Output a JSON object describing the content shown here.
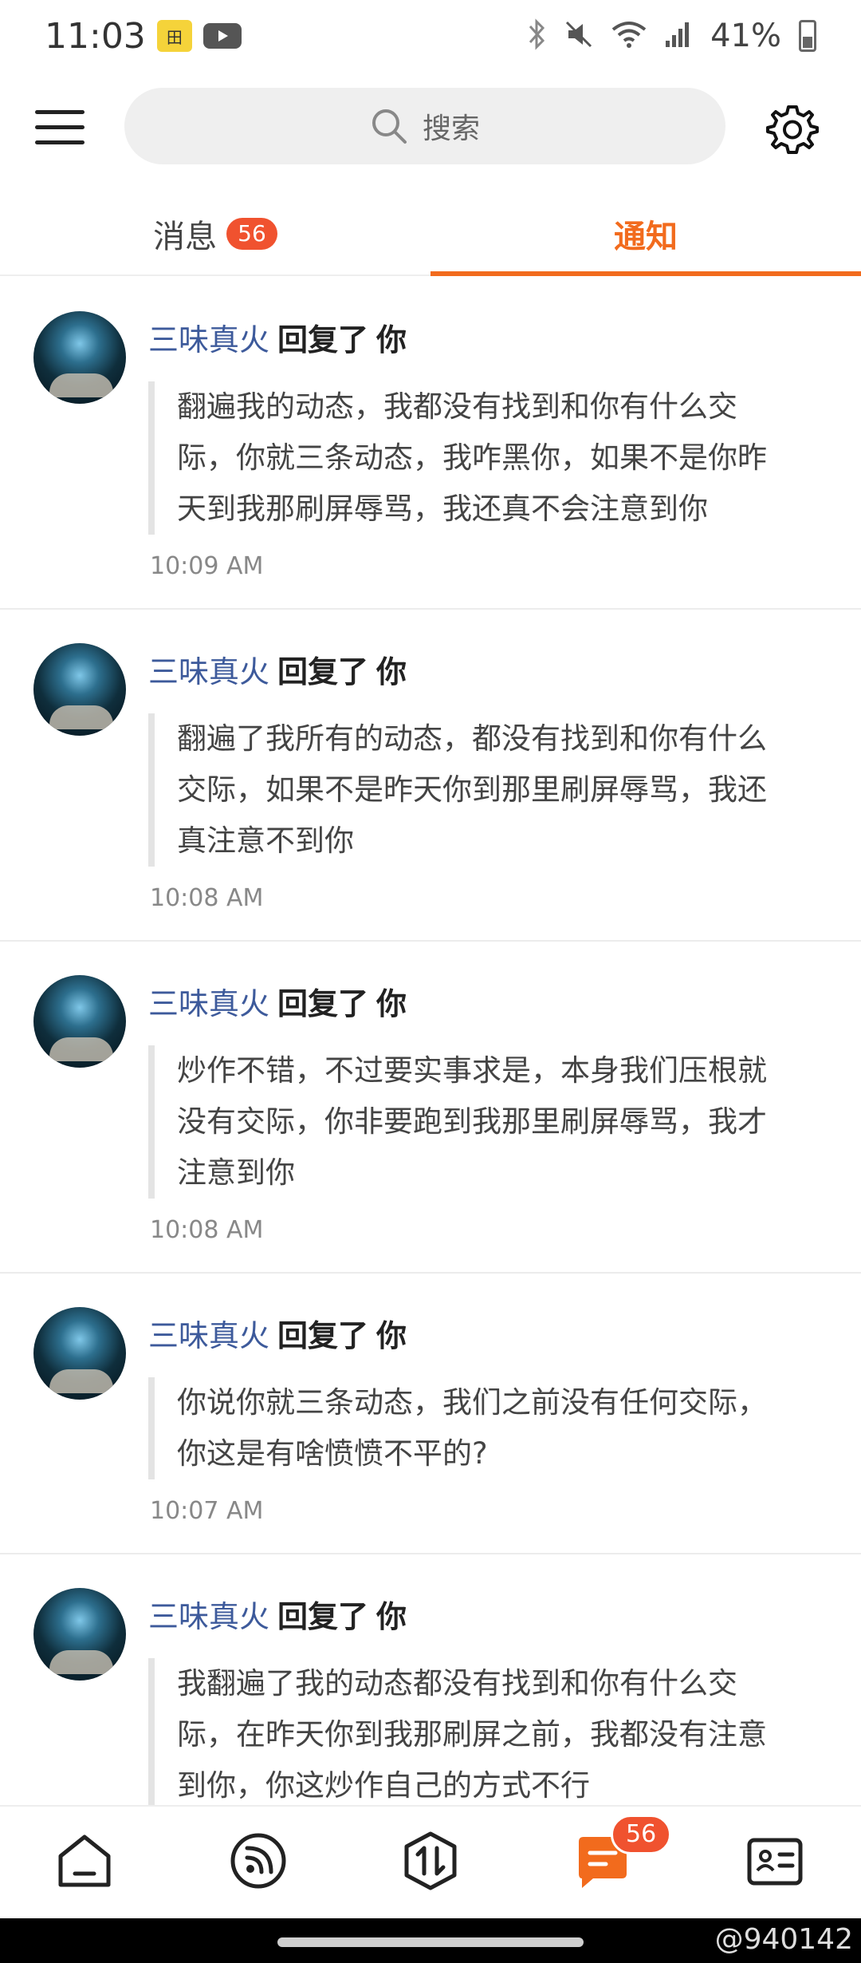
{
  "status_bar": {
    "time": "11:03",
    "battery": "41%",
    "icons": [
      "news-app-icon",
      "youtube-icon",
      "bluetooth-icon",
      "mute-icon",
      "wifi-icon",
      "signal-icon",
      "battery-icon"
    ]
  },
  "search": {
    "placeholder": "搜索"
  },
  "tabs": {
    "messages": {
      "label": "消息",
      "badge": "56"
    },
    "notices": {
      "label": "通知",
      "active": true
    }
  },
  "notifications": [
    {
      "author": "三味真火",
      "action": "回复了",
      "target": "你",
      "lines": [
        "翻遍我的动态，我都没有找到和你有什么交",
        "际，你就三条动态，我咋黑你，如果不是你昨",
        "天到我那刷屏辱骂，我还真不会注意到你"
      ],
      "time": "10:09 AM"
    },
    {
      "author": "三味真火",
      "action": "回复了",
      "target": "你",
      "lines": [
        "翻遍了我所有的动态，都没有找到和你有什么",
        "交际，如果不是昨天你到那里刷屏辱骂，我还",
        "真注意不到你"
      ],
      "time": "10:08 AM"
    },
    {
      "author": "三味真火",
      "action": "回复了",
      "target": "你",
      "lines": [
        "炒作不错，不过要实事求是，本身我们压根就",
        "没有交际，你非要跑到我那里刷屏辱骂，我才",
        "注意到你"
      ],
      "time": "10:08 AM"
    },
    {
      "author": "三味真火",
      "action": "回复了",
      "target": "你",
      "lines": [
        "你说你就三条动态，我们之前没有任何交际，",
        "你这是有啥愤愤不平的?"
      ],
      "time": "10:07 AM"
    },
    {
      "author": "三味真火",
      "action": "回复了",
      "target": "你",
      "lines": [
        "我翻遍了我的动态都没有找到和你有什么交",
        "际，在昨天你到我那刷屏之前，我都没有注意",
        "到你，你这炒作自己的方式不行"
      ],
      "time": ""
    }
  ],
  "bottom_nav": {
    "items": [
      "home-icon",
      "feed-icon",
      "exchange-icon",
      "messages-icon",
      "profile-card-icon"
    ],
    "badge": "56",
    "active_color": "#f26b1d"
  },
  "watermark": "@940142",
  "colors": {
    "accent": "#f26b1d",
    "badge": "#f0522f",
    "author": "#3d5a9b"
  }
}
